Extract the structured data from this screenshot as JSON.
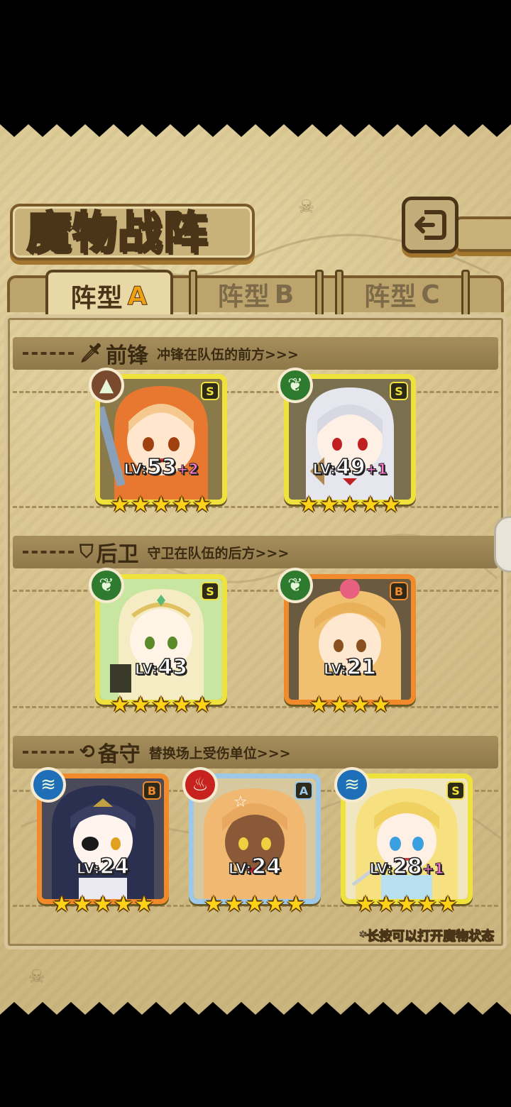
{
  "title": "魔物战阵",
  "tabs": [
    {
      "label": "阵型",
      "letter": "A",
      "active": true
    },
    {
      "label": "阵型",
      "letter": "B",
      "active": false
    },
    {
      "label": "阵型",
      "letter": "C",
      "active": false
    }
  ],
  "sections": {
    "front": {
      "title": "前锋",
      "desc": "冲锋在队伍的前方>>>",
      "icon": "sword-icon"
    },
    "back": {
      "title": "后卫",
      "desc": "守卫在队伍的后方>>>",
      "icon": "shield-icon"
    },
    "reserve": {
      "title": "备守",
      "desc": "替换场上受伤单位>>>",
      "icon": "swap-icon"
    }
  },
  "cards": {
    "f1": {
      "grade": "S",
      "element": "earth-icon",
      "lv": "53",
      "bonus": "+2",
      "stars": 5
    },
    "f2": {
      "grade": "S",
      "element": "leaf-icon",
      "lv": "49",
      "bonus": "+1",
      "stars": 5
    },
    "b1": {
      "grade": "S",
      "element": "leaf-icon",
      "lv": "43",
      "bonus": "",
      "stars": 5
    },
    "b2": {
      "grade": "B",
      "element": "leaf-icon",
      "lv": "21",
      "bonus": "",
      "stars": 4
    },
    "r1": {
      "grade": "B",
      "element": "water-icon",
      "lv": "24",
      "bonus": "",
      "stars": 5
    },
    "r2": {
      "grade": "A",
      "element": "fire-icon",
      "lv": "24",
      "bonus": "",
      "stars": 5
    },
    "r3": {
      "grade": "S",
      "element": "water-icon",
      "lv": "28",
      "bonus": "+1",
      "stars": 5
    }
  },
  "lv_prefix": "LV:",
  "hint": "*长按可以打开魔物状态",
  "colors": {
    "grade_S": "#f0e23c",
    "grade_B": "#f08a2a",
    "grade_A": "#9ec8e8",
    "leaf": "#2e7a2e",
    "water": "#1e6fb8",
    "fire": "#c8221e",
    "earth": "#7a4a2e"
  }
}
